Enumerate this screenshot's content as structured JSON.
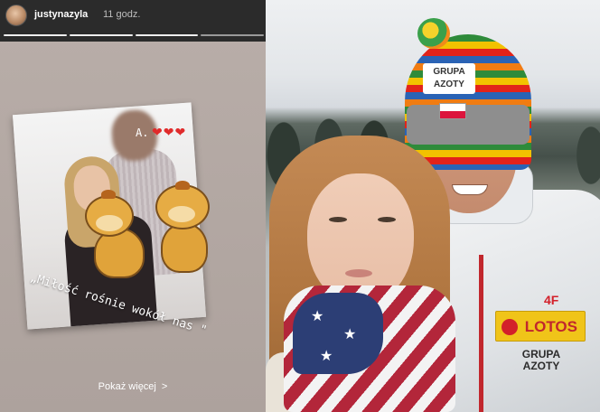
{
  "story": {
    "username": "justynazyla",
    "time": "11 godz.",
    "progress_segments": 4,
    "progress_done": 3,
    "initial": "A.",
    "hearts": "❤❤❤",
    "caption": "„Miłość rośnie wokół nas \"",
    "more_label": "Pokaż więcej",
    "more_chevron": ">"
  },
  "photo": {
    "hat_logo_line1": "GRUPA",
    "hat_logo_line2": "AZOTY",
    "jacket_brand": "4F",
    "sponsor": "LOTOS",
    "sponsor2_line1": "GRUPA",
    "sponsor2_line2": "AZOTY"
  },
  "colors": {
    "header_bg": "#2b2b2b",
    "heart": "#e02b2b",
    "lotos_yellow": "#f0c419",
    "lotos_red": "#c1272d"
  }
}
